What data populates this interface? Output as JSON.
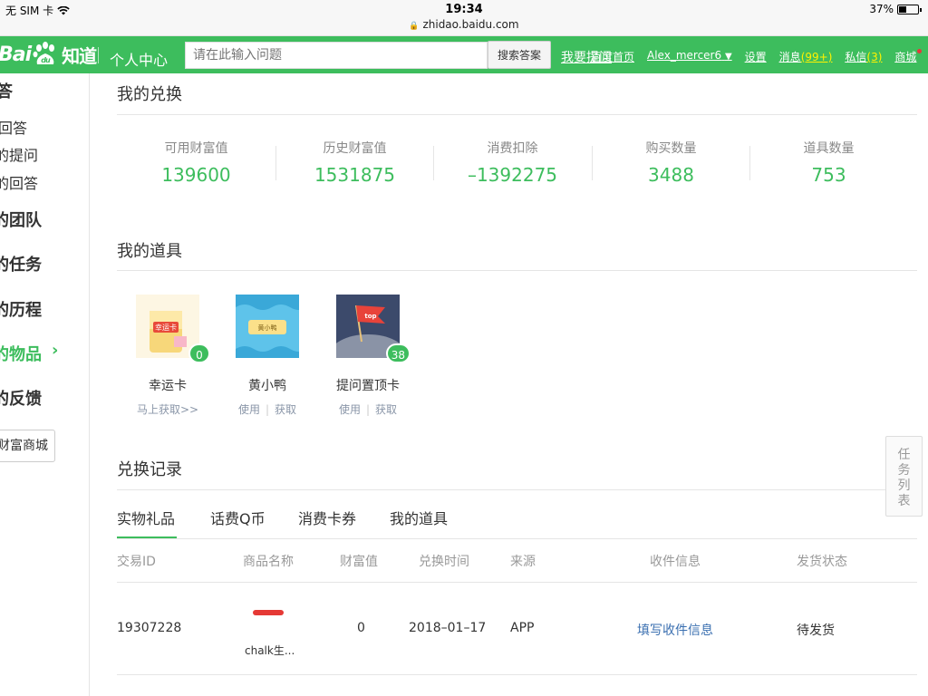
{
  "status_bar": {
    "carrier": "无 SIM 卡",
    "time": "19:34",
    "url": "zhidao.baidu.com",
    "battery": "37%",
    "battery_level": 0.37
  },
  "header": {
    "logo_text": "Bai",
    "logo_paw_text": "du",
    "logo_zh": "知道",
    "center_title": "个人中心",
    "search_placeholder": "请在此输入问题",
    "search_button": "搜索答案",
    "ask_link": "我要提问",
    "links": {
      "home": "百度首页",
      "user": "Alex_mercer6",
      "settings": "设置",
      "messages": "消息",
      "messages_count": "(99+)",
      "private": "私信",
      "private_count": "(3)",
      "mall": "商城"
    }
  },
  "sidebar": {
    "items": [
      {
        "label": "答"
      },
      {
        "label": "回答"
      },
      {
        "label": "的提问"
      },
      {
        "label": "的回答"
      },
      {
        "label": "的团队"
      },
      {
        "label": "的任务"
      },
      {
        "label": "的历程"
      },
      {
        "label": "的物品",
        "arrow": "›"
      },
      {
        "label": "的反馈"
      }
    ],
    "mall_button": "财富商城"
  },
  "exchange": {
    "title": "我的兑换",
    "stats": [
      {
        "label": "可用财富值",
        "value": "139600"
      },
      {
        "label": "历史财富值",
        "value": "1531875"
      },
      {
        "label": "消费扣除",
        "value": "–1392275"
      },
      {
        "label": "购买数量",
        "value": "3488"
      },
      {
        "label": "道具数量",
        "value": "753"
      }
    ]
  },
  "tools": {
    "title": "我的道具",
    "items": [
      {
        "name": "幸运卡",
        "badge": "0",
        "action1": "马上获取>>",
        "img_text": "幸运卡"
      },
      {
        "name": "黄小鸭",
        "action1": "使用",
        "action2": "获取",
        "img_text": "黄小鸭"
      },
      {
        "name": "提问置顶卡",
        "badge": "38",
        "action1": "使用",
        "action2": "获取",
        "img_text": "top"
      }
    ]
  },
  "records": {
    "title": "兑换记录",
    "tabs": [
      "实物礼品",
      "话费Q币",
      "消费卡券",
      "我的道具"
    ],
    "columns": [
      "交易ID",
      "商品名称",
      "财富值",
      "兑换时间",
      "来源",
      "收件信息",
      "发货状态"
    ],
    "rows": [
      {
        "id": "19307228",
        "product": "chalk生...",
        "wealth": "0",
        "time": "2018–01–17",
        "source": "APP",
        "info": "填写收件信息",
        "status": "待发货"
      }
    ]
  },
  "task_list": "任务列表"
}
